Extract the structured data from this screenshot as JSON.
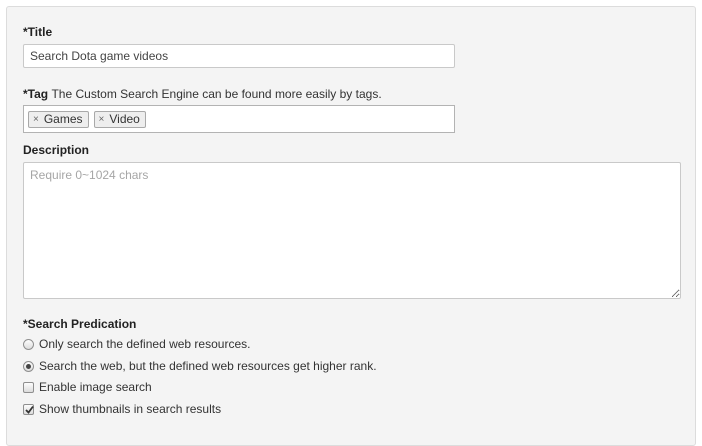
{
  "title_field": {
    "label": "*Title",
    "value": "Search Dota game videos"
  },
  "tag_field": {
    "label": "*Tag",
    "hint": "The Custom Search Engine can be found more easily by tags.",
    "remove_glyph": "×",
    "tags": [
      "Games",
      "Video"
    ]
  },
  "description_field": {
    "label": "Description",
    "placeholder": "Require 0~1024 chars"
  },
  "search_predication": {
    "label": "*Search Predication",
    "radio_options": [
      {
        "label": "Only search the defined web resources.",
        "selected": false
      },
      {
        "label": "Search the web, but the defined web resources get higher rank.",
        "selected": true
      }
    ],
    "checkboxes": [
      {
        "label": "Enable image search",
        "checked": false
      },
      {
        "label": "Show thumbnails in search results",
        "checked": true
      }
    ]
  }
}
